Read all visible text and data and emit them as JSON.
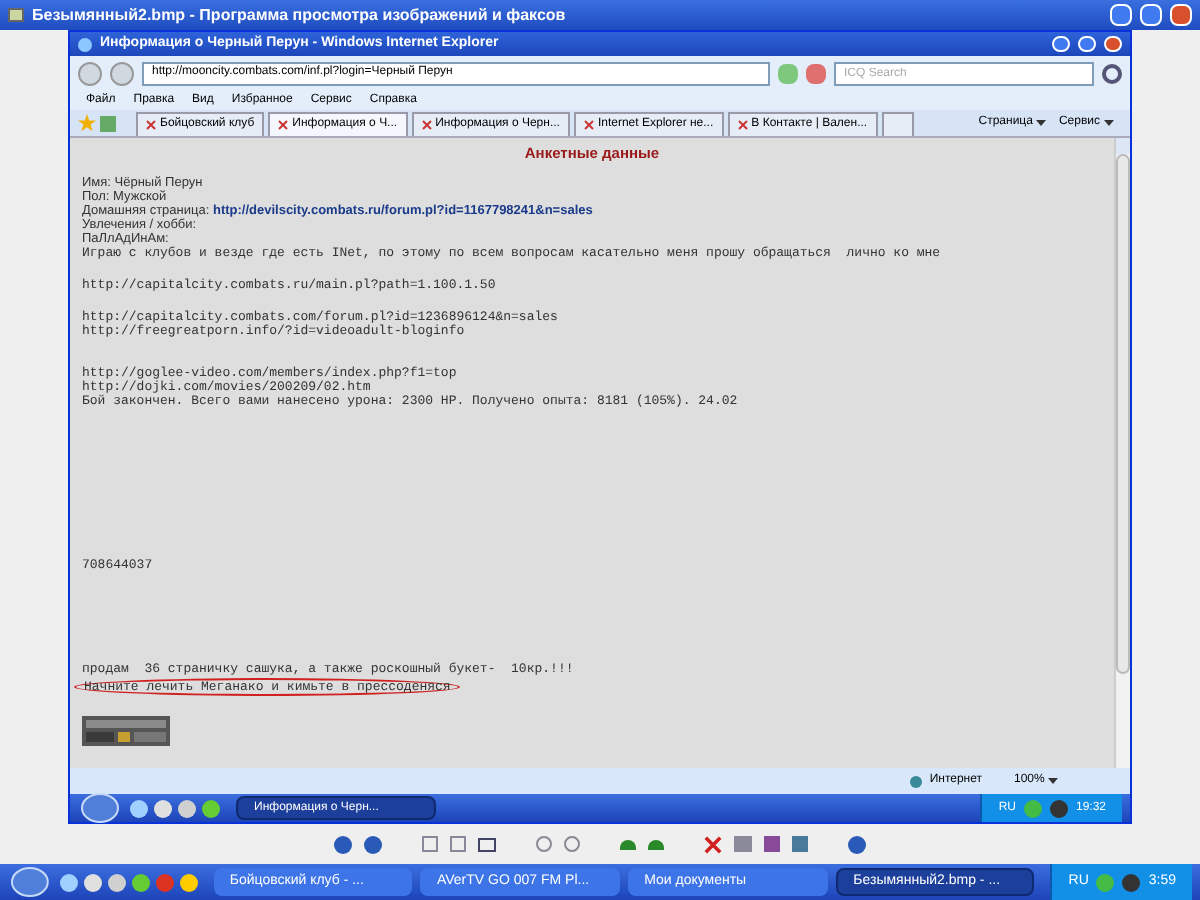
{
  "viewer": {
    "title": "Безымянный2.bmp - Программа просмотра изображений и факсов"
  },
  "browser": {
    "title": "Информация о Черный Перун - Windows Internet Explorer",
    "address": "http://mooncity.combats.com/inf.pl?login=Черный Перун",
    "search": {
      "placeholder": "ICQ Search"
    },
    "menu": [
      "Файл",
      "Правка",
      "Вид",
      "Избранное",
      "Сервис",
      "Справка"
    ],
    "tabs": [
      {
        "label": "Бойцовский клуб",
        "selected": false
      },
      {
        "label": "Информация о Ч...",
        "selected": true
      },
      {
        "label": "Информация о Черн...",
        "selected": false
      },
      {
        "label": "Internet Explorer не...",
        "selected": false
      },
      {
        "label": "В Контакте | Вален...",
        "selected": false
      }
    ],
    "toolbar": [
      "Страница",
      "Сервис"
    ],
    "page": {
      "heading": "Анкетные данные",
      "profile": [
        {
          "label": "Имя:",
          "value": "Чёрный Перун"
        },
        {
          "label": "Пол:",
          "value": "Мужской"
        },
        {
          "label": "Домашняя страница:",
          "link": "http://devilscity.combats.ru/forum.pl?id=1167798241&n=sales"
        },
        {
          "label": "Увлечения / хобби:"
        },
        {
          "label": "ПаЛлАдИнАм:"
        }
      ],
      "blocks": [
        [
          {
            "text": "Играю с клубов и везде где есть INet, по этому по всем вопросам касательно меня прошу обращаться  лично ко мне",
            "circled": false
          }
        ],
        [
          {
            "text": "http://capitalcity.combats.ru/main.pl?path=1.100.1.50",
            "circled": false
          }
        ],
        [
          {
            "text": "http://capitalcity.combats.com/forum.pl?id=1236896124&n=sales",
            "circled": false
          },
          {
            "text": "http://freegreatporn.info/?id=videoadult-bloginfo",
            "circled": false
          }
        ],
        [
          {
            "text": "http://goglee-video.com/members/index.php?f1=top",
            "circled": false
          },
          {
            "text": "http://dojki.com/movies/200209/02.htm",
            "circled": false
          },
          {
            "text": "Бой закончен. Всего вами нанесено урона: 2300 HP. Получено опыта: 8181 (105%). 24.02",
            "circled": false
          }
        ],
        [
          {
            "text": "708644037",
            "circled": false
          }
        ],
        [
          {
            "text": "продам  36 страничку сашука, а также роскошный букет-  10кр.!!!",
            "circled": false
          },
          {
            "text": "Начните лечить Меганако и кимьте в прессоденяся",
            "circled": true
          }
        ]
      ]
    }
  },
  "status": {
    "zone": "Интернет",
    "zoom": "100%"
  },
  "inner_taskbar": {
    "windows": [
      {
        "label": "Информация о Черн...",
        "selected": true
      }
    ],
    "lang": "RU",
    "clock": "19:32"
  },
  "taskbar": {
    "windows": [
      {
        "label": "Бойцовский клуб - ...",
        "selected": false
      },
      {
        "label": "AVerTV GO 007 FM Pl...",
        "selected": false
      },
      {
        "label": "Мои документы",
        "selected": false
      },
      {
        "label": "Безымянный2.bmp - ...",
        "selected": true
      }
    ],
    "lang": "RU",
    "clock": "3:59"
  }
}
